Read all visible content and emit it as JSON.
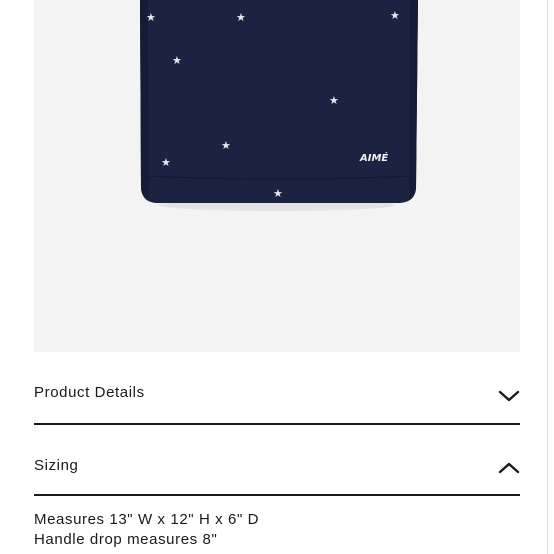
{
  "product": {
    "brand_mark": "AIMÉ",
    "bag_color": "#1c2340",
    "background_color": "#f3f3f3"
  },
  "accordion": {
    "product_details": {
      "label": "Product Details",
      "icon": "chevron-down-icon",
      "expanded": false
    },
    "sizing": {
      "label": "Sizing",
      "icon": "chevron-up-icon",
      "expanded": true,
      "lines": [
        "Measures 13\" W x 12\" H x 6\" D",
        "Handle drop measures 8\""
      ]
    }
  }
}
